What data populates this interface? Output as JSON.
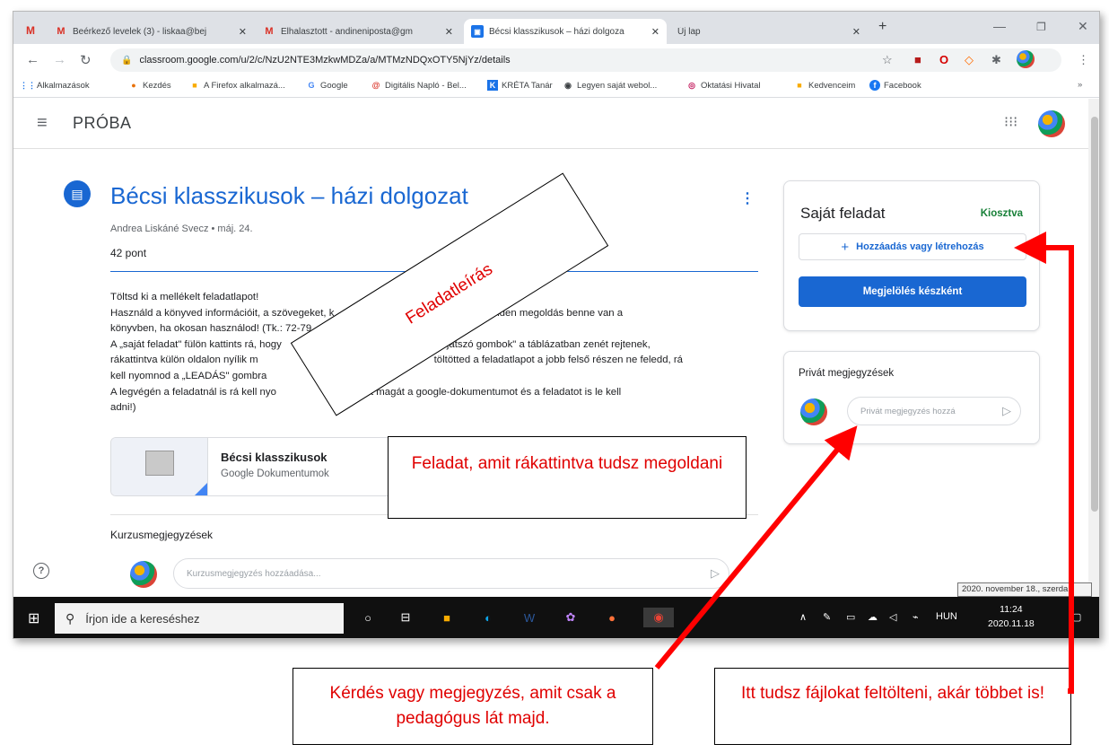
{
  "browser": {
    "tabs": [
      {
        "label": "Beérkező levelek (3) - liskaa@bej",
        "favicon": "gmail-icon"
      },
      {
        "label": "Elhalasztott - andineniposta@gm",
        "favicon": "gmail-icon"
      },
      {
        "label": "Bécsi klasszikusok – házi dolgoza",
        "favicon": "classroom-icon"
      },
      {
        "label": "Új lap",
        "favicon": ""
      }
    ],
    "url": "classroom.google.com/u/2/c/NzU2NTE3MzkwMDZa/a/MTMzNDQxOTY5NjYz/details",
    "bookmarks": [
      "Alkalmazások",
      "Kezdés",
      "A Firefox alkalmazá...",
      "Google",
      "Digitális Napló - Bel...",
      "KRÉTA Tanár",
      "Legyen saját webol...",
      "Oktatási Hivatal",
      "Kedvenceim",
      "Facebook"
    ]
  },
  "header": {
    "course_name": "PRÓBA"
  },
  "assignment": {
    "title": "Bécsi klasszikusok – házi dolgozat",
    "meta": "Andrea Liskáné Svecz • máj. 24.",
    "points": "42 pont",
    "description": [
      "Töltsd ki a mellékelt feladatlapot!",
      "Használd a könyved információit, a szövegeket, k",
      "okat! Minden megoldás benne van a",
      "könyvben, ha okosan használod! (Tk.: 72-79",
      "A „saját feladat\" fülön kattints rá, hogy",
      "játszó gombok\" a táblázatban zenét rejtenek,",
      "rákattintva külön oldalon nyílik m",
      "töltötted a feladatlapot a jobb felső részen ne feledd, rá",
      "kell nyomnod a „LEADÁS\" gombra",
      "A legvégén a feladatnál is rá kell nyo",
      "-ra (tehát magát a google-dokumentumot és a feladatot is le kell",
      "adni!)"
    ],
    "attachment": {
      "title": "Bécsi klasszikusok",
      "subtitle": "Google Dokumentumok"
    }
  },
  "comments": {
    "heading": "Kurzusmegjegyzések",
    "placeholder": "Kurzusmegjegyzés hozzáadása..."
  },
  "your_work": {
    "title": "Saját feladat",
    "status": "Kiosztva",
    "add_label": "Hozzáadás vagy létrehozás",
    "mark_label": "Megjelölés készként"
  },
  "private_comments": {
    "title": "Privát megjegyzések",
    "placeholder": "Privát megjegyzés hozzá"
  },
  "taskbar": {
    "search_placeholder": "Írjon ide a kereséshez",
    "language": "HUN",
    "time": "11:24",
    "date_partial": "2020.11.18",
    "date_tooltip": "2020. november 18., szerda"
  },
  "annotations": {
    "task_description": "Feladatleírás",
    "task_click": "Feladat, amit rákattintva tudsz megoldani",
    "private_note": "Kérdés vagy megjegyzés, amit csak a pedagógus lát majd.",
    "upload_note": "Itt tudsz fájlokat feltölteni, akár többet is!"
  },
  "colors": {
    "classroom_blue": "#1967d2",
    "status_green": "#188038",
    "annotation_red": "#e00000"
  }
}
